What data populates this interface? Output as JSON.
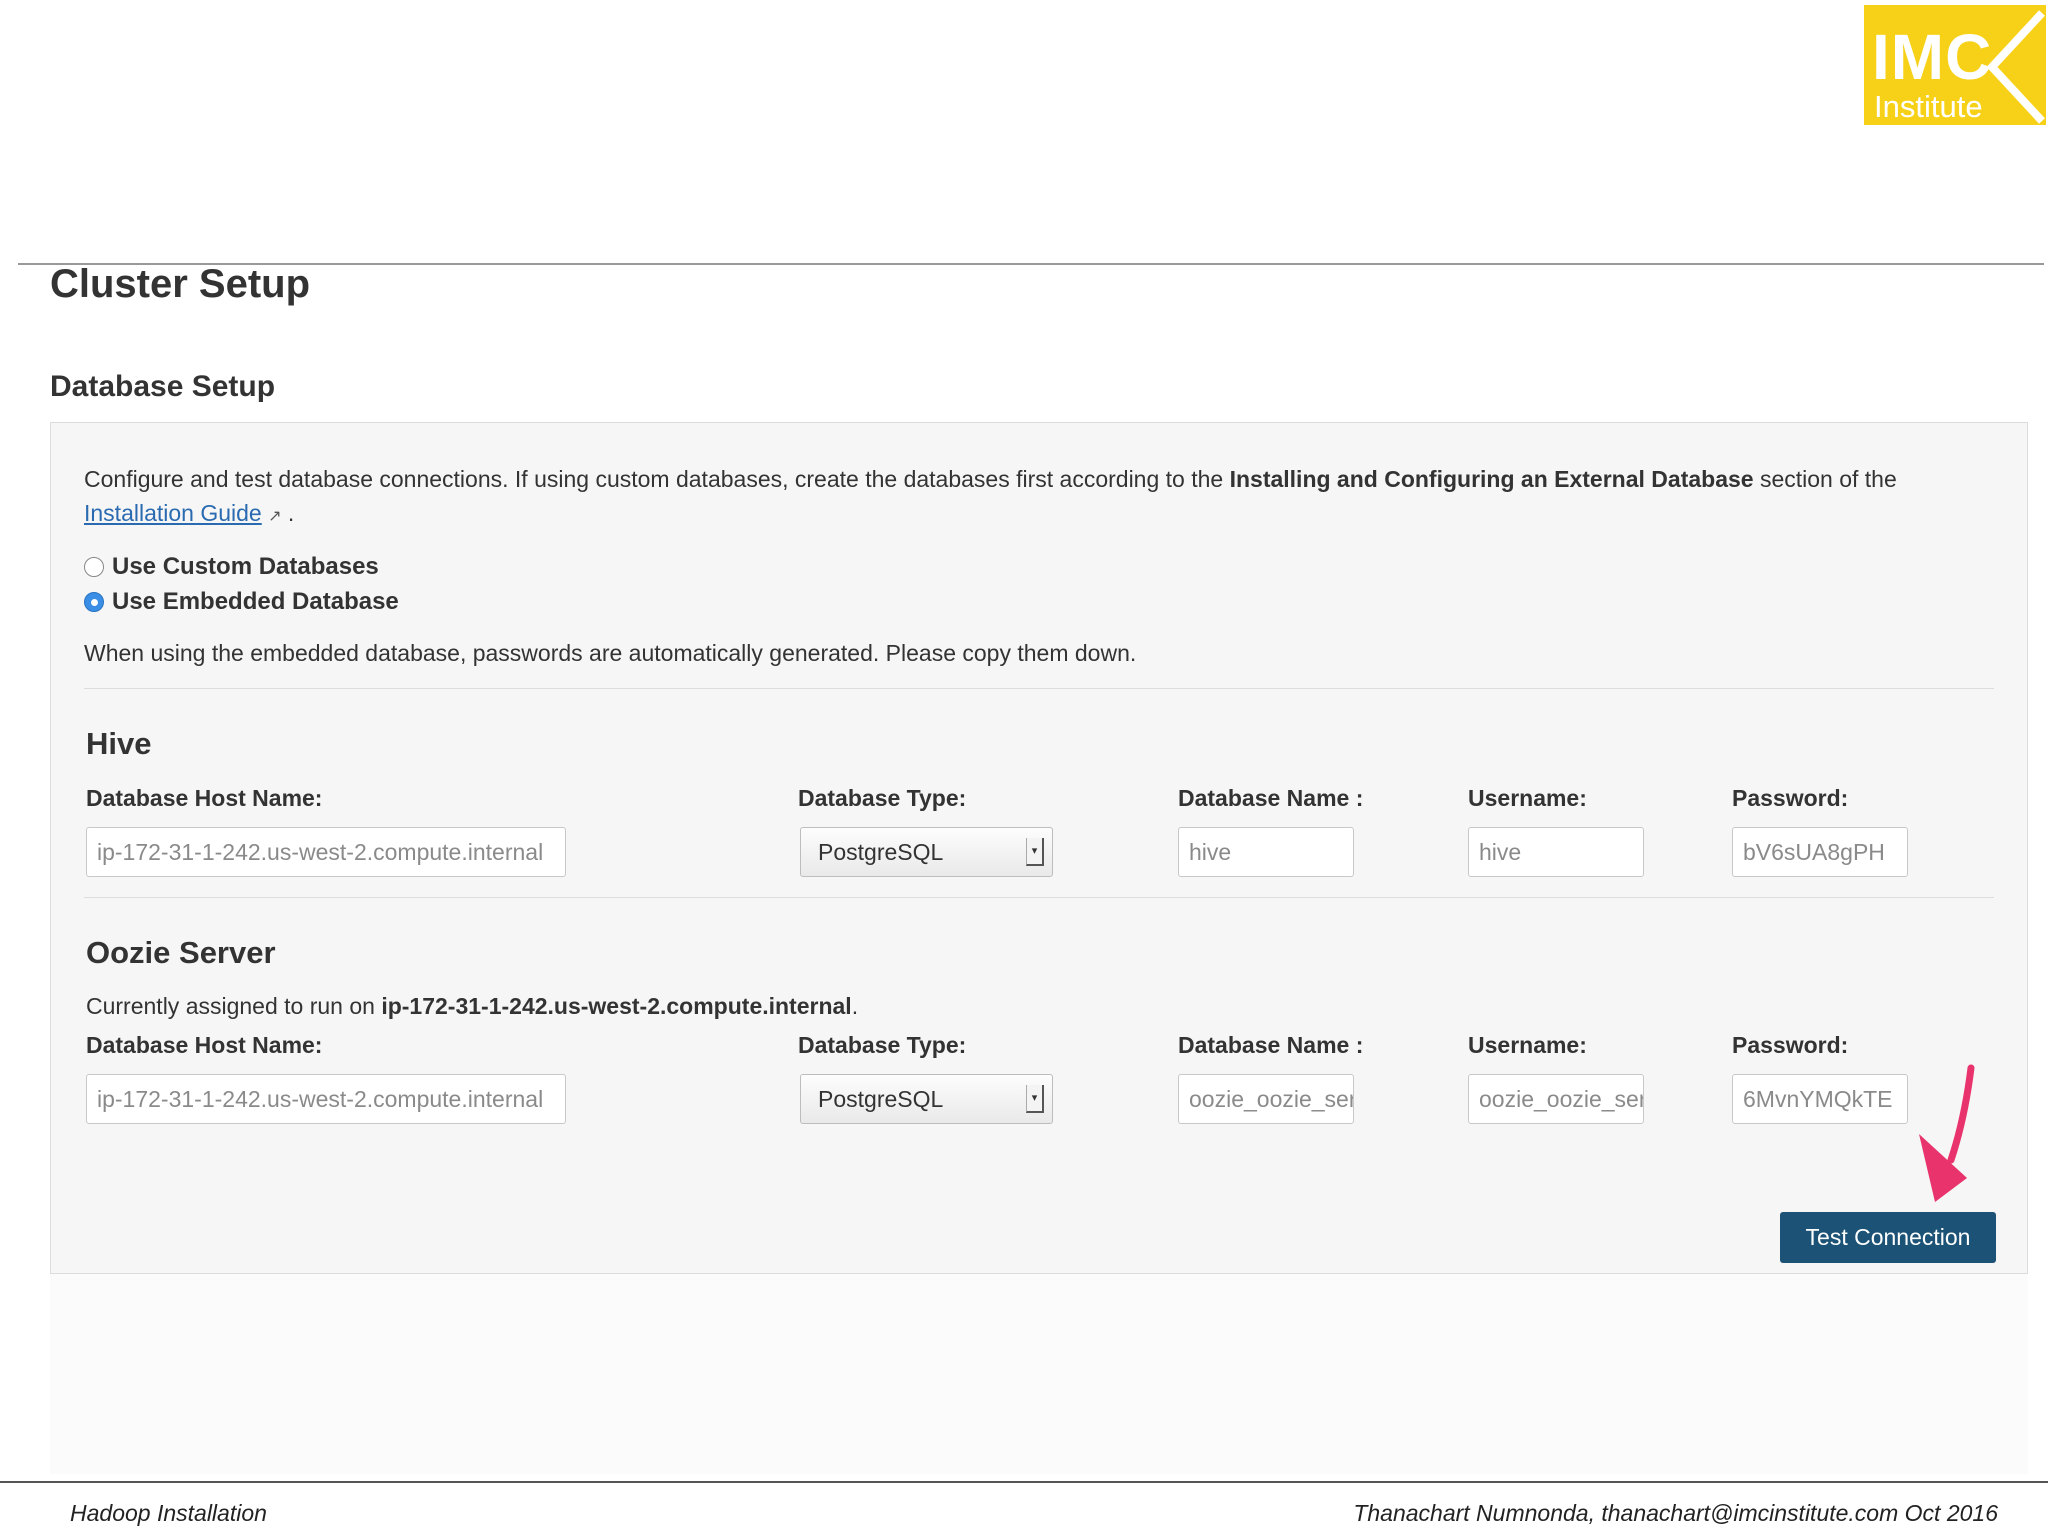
{
  "logo": {
    "line1": "IMC",
    "line2": "Institute",
    "color": "#f7d117"
  },
  "page_title": "Cluster Setup",
  "section_title": "Database Setup",
  "intro": {
    "text_before": "Configure and test database connections. If using custom databases, create the databases first according to the ",
    "bold_text": "Installing and Configuring an External Database",
    "text_after": " section of the",
    "link_text": "Installation Guide",
    "trailing": " ."
  },
  "radio_options": [
    {
      "label": "Use Custom Databases",
      "checked": false
    },
    {
      "label": "Use Embedded Database",
      "checked": true
    }
  ],
  "embedded_note": "When using the embedded database, passwords are automatically generated. Please copy them down.",
  "labels": {
    "host": "Database Host Name:",
    "type": "Database Type:",
    "name": "Database Name :",
    "username": "Username:",
    "password": "Password:"
  },
  "services": [
    {
      "title": "Hive",
      "host": "ip-172-31-1-242.us-west-2.compute.internal",
      "type": "PostgreSQL",
      "db_name": "hive",
      "username": "hive",
      "password": "bV6sUA8gPH"
    },
    {
      "title": "Oozie Server",
      "assigned_prefix": "Currently assigned to run on ",
      "assigned_host": "ip-172-31-1-242.us-west-2.compute.internal",
      "assigned_suffix": ".",
      "host": "ip-172-31-1-242.us-west-2.compute.internal",
      "type": "PostgreSQL",
      "db_name": "oozie_oozie_server",
      "username": "oozie_oozie_server",
      "password": "6MvnYMQkTE"
    }
  ],
  "test_button": "Test Connection",
  "accent_color": "#1b5275",
  "arrow_color": "#e8336d",
  "footer": {
    "left": "Hadoop Installation",
    "right": "Thanachart Numnonda,  thanachart@imcinstitute.com  Oct 2016"
  }
}
